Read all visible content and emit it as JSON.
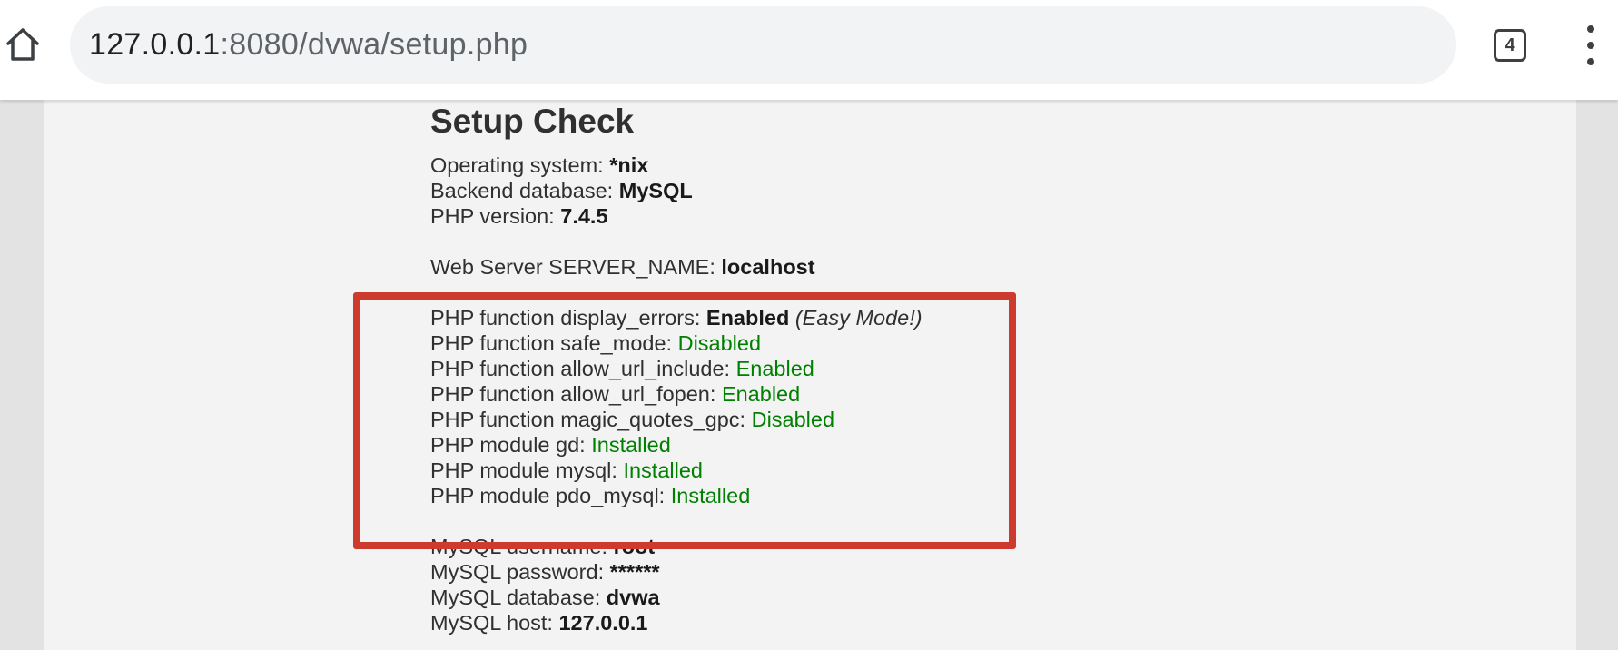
{
  "browser": {
    "url_host": "127.0.0.1",
    "url_path": ":8080/dvwa/setup.php",
    "tab_count": "4"
  },
  "page": {
    "title": "Setup Check",
    "system_info": [
      {
        "label": "Operating system: ",
        "value": "*nix"
      },
      {
        "label": "Backend database: ",
        "value": "MySQL"
      },
      {
        "label": "PHP version: ",
        "value": "7.4.5"
      }
    ],
    "server_name": {
      "label": "Web Server SERVER_NAME: ",
      "value": "localhost"
    },
    "display_errors": {
      "label": "PHP function display_errors: ",
      "value": "Enabled",
      "note": "(Easy Mode!)"
    },
    "php_checks": [
      {
        "label": "PHP function safe_mode: ",
        "value": "Disabled"
      },
      {
        "label": "PHP function allow_url_include: ",
        "value": "Enabled"
      },
      {
        "label": "PHP function allow_url_fopen: ",
        "value": "Enabled"
      },
      {
        "label": "PHP function magic_quotes_gpc: ",
        "value": "Disabled"
      },
      {
        "label": "PHP module gd: ",
        "value": "Installed"
      },
      {
        "label": "PHP module mysql: ",
        "value": "Installed"
      },
      {
        "label": "PHP module pdo_mysql: ",
        "value": "Installed"
      }
    ],
    "mysql_info": [
      {
        "label": "MySQL username: ",
        "value": "root"
      },
      {
        "label": "MySQL password: ",
        "value": "******"
      },
      {
        "label": "MySQL database: ",
        "value": "dvwa"
      },
      {
        "label": "MySQL host: ",
        "value": "127.0.0.1"
      }
    ]
  },
  "colors": {
    "enabled_status": "#008000",
    "highlight_border": "#cd3a2e"
  }
}
